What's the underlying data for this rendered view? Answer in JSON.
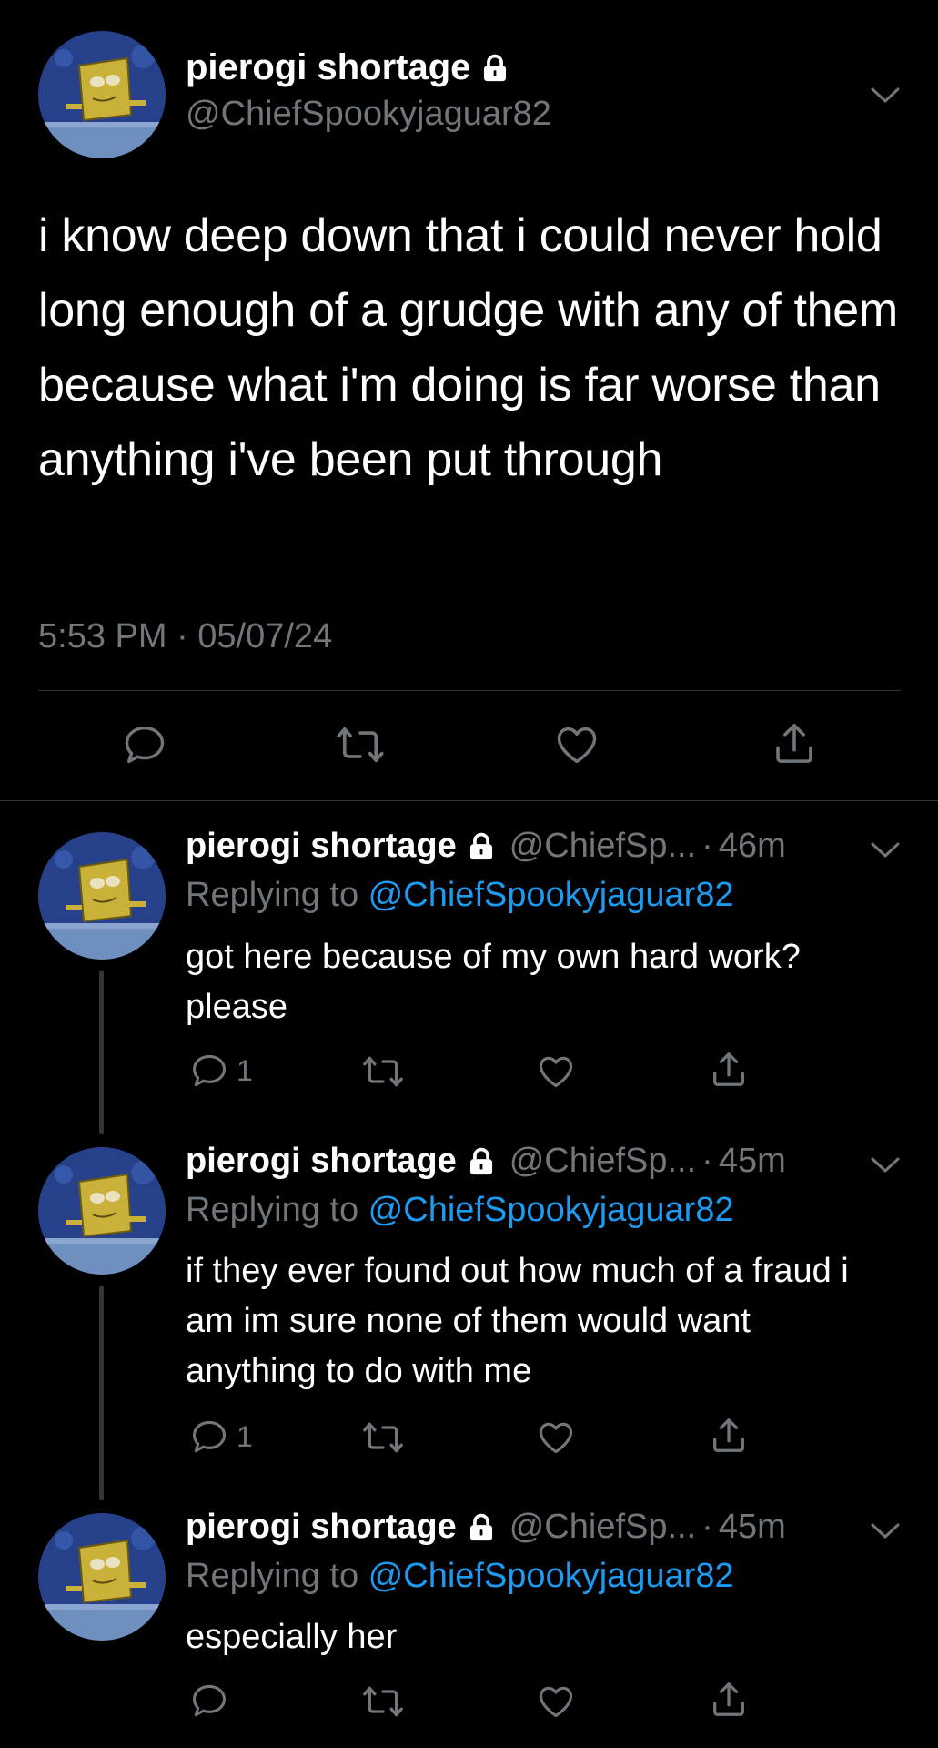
{
  "main_tweet": {
    "display_name": "pierogi shortage",
    "handle": "@ChiefSpookyjaguar82",
    "text": "i know deep down that i could never hold long enough of a grudge with any of them because what i'm doing is far worse than anything i've been put through",
    "timestamp": "5:53 PM · 05/07/24",
    "locked": true
  },
  "replies": [
    {
      "display_name": "pierogi shortage",
      "handle": "@ChiefSp...",
      "separator": "·",
      "age": "46m",
      "replying_prefix": "Replying to ",
      "replying_to": "@ChiefSpookyjaguar82",
      "text": "got here because of my own hard work? please",
      "reply_count": "1"
    },
    {
      "display_name": "pierogi shortage",
      "handle": "@ChiefSp...",
      "separator": "·",
      "age": "45m",
      "replying_prefix": "Replying to ",
      "replying_to": "@ChiefSpookyjaguar82",
      "text": "if they ever found out how much of a fraud i am im sure none of them would want anything to do with me",
      "reply_count": "1"
    },
    {
      "display_name": "pierogi shortage",
      "handle": "@ChiefSp...",
      "separator": "·",
      "age": "45m",
      "replying_prefix": "Replying to ",
      "replying_to": "@ChiefSpookyjaguar82",
      "text": "especially her",
      "reply_count": ""
    }
  ],
  "icons": {
    "reply": "speech-bubble-icon",
    "retweet": "retweet-arrows-icon",
    "like": "heart-icon",
    "share": "share-upload-icon",
    "lock": "padlock-icon",
    "more": "chevron-down-icon"
  },
  "colors": {
    "background": "#000000",
    "text_primary": "#ffffff",
    "text_secondary": "#71767b",
    "link": "#1d9bf0",
    "divider": "#2f3336"
  }
}
